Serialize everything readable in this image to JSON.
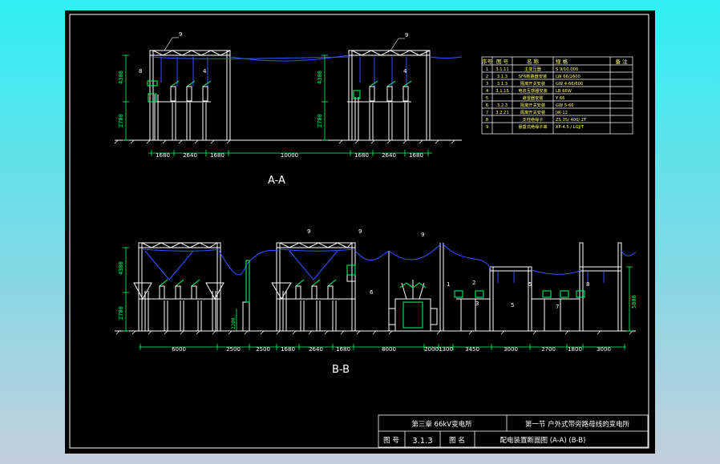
{
  "colors": {
    "background_top": "#2ff0f4",
    "background_bottom": "#c4cfdc",
    "sheet": "#000000",
    "steel": "#ffffff",
    "bus": "#3355ff",
    "dimension": "#00ff66",
    "equipment": "#00ff66"
  },
  "view_aa": {
    "title": "A-A",
    "height_upper": "4300",
    "height_lower": "2700",
    "dimensions": [
      "1680",
      "2640",
      "1680",
      "10000",
      "1680",
      "2640",
      "1680"
    ],
    "labels": [
      "9",
      "8",
      "4",
      "9",
      "4"
    ]
  },
  "view_bb": {
    "title": "B-B",
    "height_upper": "4300",
    "height_lower": "2700",
    "height_right": "5800",
    "height_small": "2200",
    "dimensions": [
      "6000",
      "2500",
      "2500",
      "1680",
      "2640",
      "1680",
      "8000",
      "2000",
      "1300",
      "3450",
      "3000",
      "2700",
      "1800",
      "3000"
    ],
    "labels": [
      "9",
      "9",
      "9",
      "6",
      "1",
      "2",
      "3",
      "5",
      "7",
      "5",
      "8"
    ]
  },
  "equipment_table": {
    "headers": [
      "序号",
      "图 号",
      "名 称",
      "规 格",
      "备 注"
    ],
    "rows": [
      [
        "1",
        "3.1.11",
        "主变压器",
        "S 9/10.000",
        ""
      ],
      [
        "2",
        "3.1.3",
        "SF6断路器安装",
        "LW 66/1600",
        ""
      ],
      [
        "3",
        "3.1.3",
        "隔离开关安装",
        "GW 4-66/600",
        ""
      ],
      [
        "4",
        "3.1.15",
        "电流互感器安装",
        "LB 66W",
        ""
      ],
      [
        "5",
        "",
        "避雷器安装",
        "Y 66",
        ""
      ],
      [
        "6",
        "3.2.3",
        "隔离开关安装",
        "GW 5-66",
        ""
      ],
      [
        "7",
        "3.2.21",
        "隔离开关安装",
        "JW-12",
        ""
      ],
      [
        "8",
        "",
        "支柱绝缘子",
        "ZS 35/ 400/ 2T",
        ""
      ],
      [
        "9",
        "",
        "悬垂式绝缘子串",
        "XP-4.5 / LGJ/T",
        ""
      ]
    ]
  },
  "title_block": {
    "chapter": "第三章  66kV变电所",
    "section": "第一节  户外式带旁路母线的变电所",
    "fig_no_label": "图 号",
    "fig_no": "3.1.3",
    "name_label": "图 名",
    "name": "配电装置断面图 (A-A)  (B-B)"
  }
}
